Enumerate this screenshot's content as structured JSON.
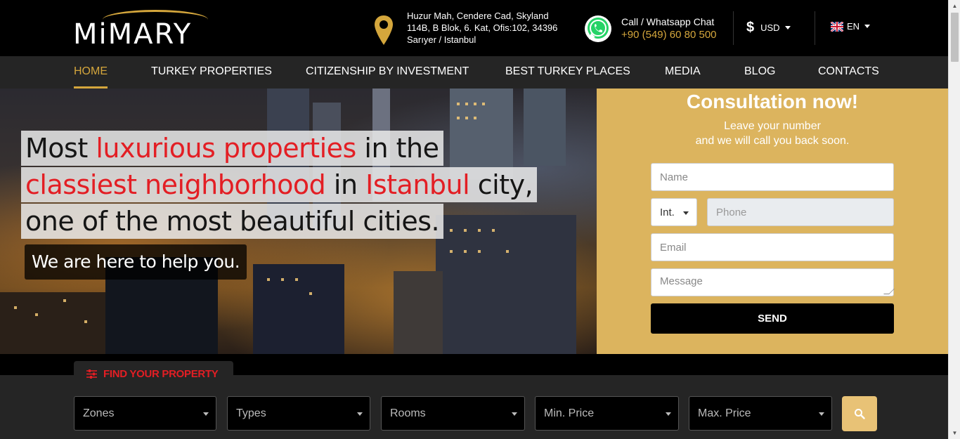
{
  "header": {
    "logo_text": "MiMARY",
    "address": {
      "line1": "Huzur Mah, Cendere Cad, Skyland",
      "line2": "114B, B Blok, 6. Kat, Ofis:102, 34396",
      "line3": "Sarıyer / Istanbul",
      "icon": "map-pin-icon"
    },
    "contact": {
      "label": "Call / Whatsapp Chat",
      "phone": "+90 (549) 60 80 500",
      "icon": "whatsapp-icon"
    },
    "currency": {
      "symbol": "$",
      "code": "USD"
    },
    "language": {
      "code": "EN",
      "flag": "uk-flag-icon"
    }
  },
  "nav": {
    "items": [
      {
        "label": "HOME",
        "active": true
      },
      {
        "label": "TURKEY PROPERTIES",
        "active": false
      },
      {
        "label": "CITIZENSHIP BY INVESTMENT",
        "active": false
      },
      {
        "label": "BEST TURKEY PLACES",
        "active": false
      },
      {
        "label": "MEDIA",
        "active": false
      },
      {
        "label": "BLOG",
        "active": false
      },
      {
        "label": "CONTACTS",
        "active": false
      }
    ]
  },
  "hero": {
    "line1": {
      "a": "Most ",
      "b": "luxurious properties",
      "c": " in the"
    },
    "line2": {
      "a": "classiest neighborhood",
      "b": " in ",
      "c": "Istanbul",
      "d": " city,"
    },
    "line3": "one of the most beautiful cities.",
    "help": "We are here to help you."
  },
  "consultation": {
    "title": "Consultation now!",
    "subtitle1": "Leave your number",
    "subtitle2": "and we will call you back soon.",
    "name_placeholder": "Name",
    "country_code": "Int.",
    "phone_placeholder": "Phone",
    "email_placeholder": "Email",
    "message_placeholder": "Message",
    "send_label": "SEND"
  },
  "search": {
    "tab_label": "FIND YOUR PROPERTY",
    "filters": [
      "Zones",
      "Types",
      "Rooms",
      "Min. Price",
      "Max. Price"
    ],
    "search_icon": "search-icon"
  },
  "colors": {
    "gold": "#d4a63c",
    "consult_bg": "#dcb45e",
    "accent_red": "#e31e24",
    "nav_bg": "#252525"
  }
}
